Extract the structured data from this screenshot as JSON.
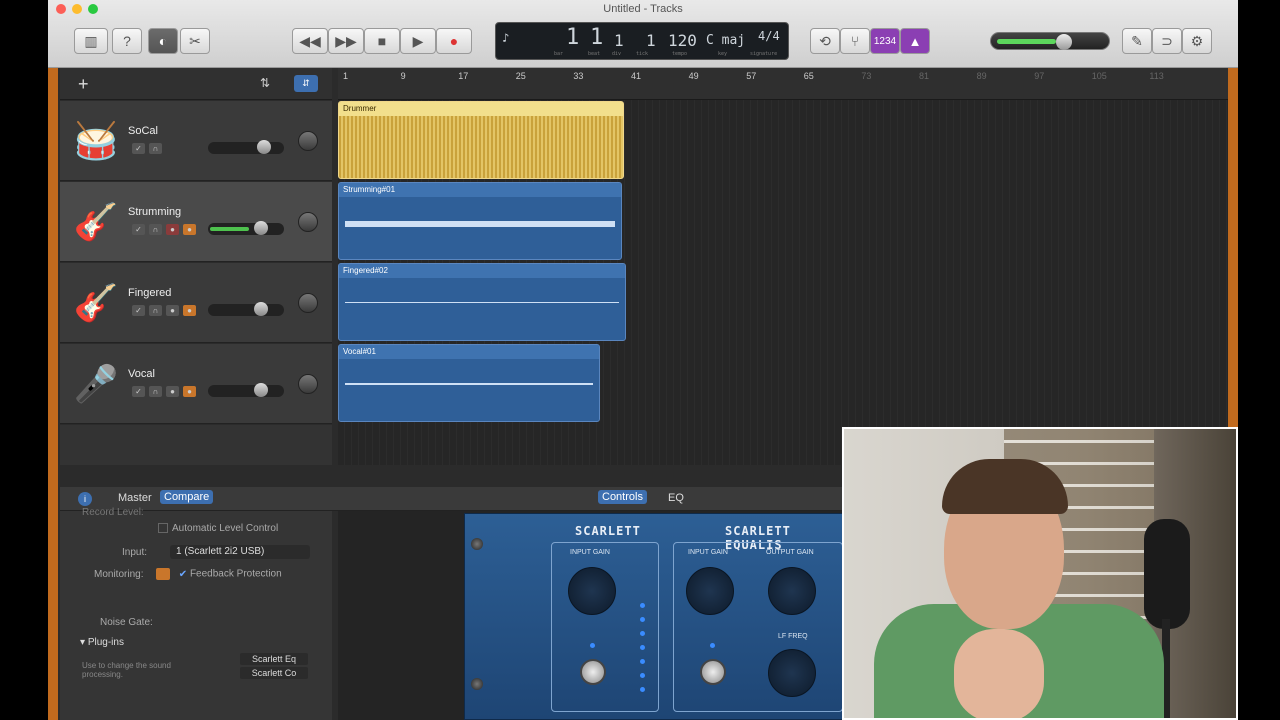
{
  "window": {
    "title": "Untitled - Tracks"
  },
  "toolbar": {
    "library_icon": "library-icon",
    "help_icon": "help-icon",
    "smart_controls_icon": "smart-controls-icon",
    "editors_icon": "editors-icon",
    "rewind_icon": "rewind-icon",
    "forward_icon": "fast-forward-icon",
    "stop_icon": "stop-icon",
    "play_icon": "play-icon",
    "record_icon": "record-icon",
    "cycle_icon": "cycle-icon",
    "tuner_icon": "tuner-icon",
    "count_in_label": "1234",
    "metronome_icon": "metronome-icon",
    "notepad_icon": "notepad-icon",
    "loop_browser_icon": "loop-icon",
    "media_browser_icon": "media-icon",
    "master_volume": 0.55
  },
  "lcd": {
    "bar": "1",
    "beat": "1",
    "div": "1",
    "tick": "1",
    "tempo": "120",
    "key": "C maj",
    "signature": "4/4",
    "bar_label": "bar",
    "beat_label": "beat",
    "div_label": "div",
    "tick_label": "tick",
    "tempo_label": "tempo",
    "key_label": "key",
    "signature_label": "signature"
  },
  "ruler": {
    "marks": [
      "1",
      "9",
      "17",
      "25",
      "33",
      "41",
      "49",
      "57",
      "65",
      "73",
      "81",
      "89",
      "97",
      "105",
      "113"
    ]
  },
  "tracks": [
    {
      "name": "SoCal",
      "icon": "drum-kit-icon",
      "volume": 0.75,
      "level": 0,
      "selected": false
    },
    {
      "name": "Strumming",
      "icon": "acoustic-guitar-icon",
      "volume": 0.72,
      "level": 0.55,
      "selected": true
    },
    {
      "name": "Fingered",
      "icon": "acoustic-guitar-icon",
      "volume": 0.72,
      "level": 0,
      "selected": false
    },
    {
      "name": "Vocal",
      "icon": "vocal-icon",
      "volume": 0.72,
      "level": 0,
      "selected": false
    }
  ],
  "regions": [
    {
      "name": "Drummer",
      "track": 0
    },
    {
      "name": "Strumming#01",
      "track": 1
    },
    {
      "name": "Fingered#02",
      "track": 2
    },
    {
      "name": "Vocal#01",
      "track": 3
    }
  ],
  "bottom": {
    "master_tab": "Master",
    "compare_tab": "Compare",
    "controls_tab": "Controls",
    "eq_tab": "EQ"
  },
  "inspector": {
    "record_level": "Record Level:",
    "auto_level": "Automatic Level Control",
    "input_label": "Input:",
    "input_value": "1 (Scarlett 2i2 USB)",
    "monitoring_label": "Monitoring:",
    "feedback": "Feedback Protection",
    "noise_gate": "Noise Gate:",
    "plugins_title": "Plug-ins",
    "plugins_hint": "Use to change the sound processing.",
    "plugin_1": "Scarlett Eq",
    "plugin_2": "Scarlett Co"
  },
  "plugin": {
    "brand_left": "SCARLETT",
    "brand_right": "SCARLETT EQUALIS",
    "input_gain": "INPUT GAIN",
    "input_gain_2": "INPUT GAIN",
    "output_gain": "OUTPUT GAIN",
    "lf_freq": "LF FREQ"
  }
}
